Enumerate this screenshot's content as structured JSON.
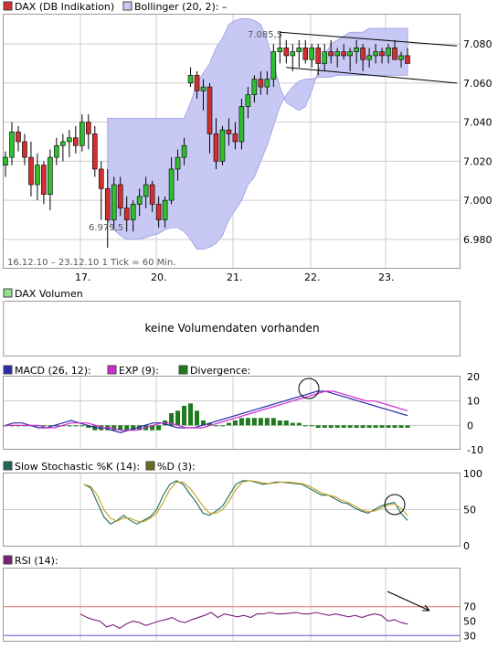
{
  "x_ticks": [
    "17.",
    "20.",
    "21.",
    "22.",
    "23."
  ],
  "info_text": "16.12.10 – 23.12.10    1 Tick = 60 Min.",
  "colors": {
    "up": "#2fbf2f",
    "down": "#d23030",
    "band_fill": "#c8c8f5",
    "band_line": "#9a9ae6",
    "macd": "#2a2aaa",
    "exp": "#d02bd0",
    "divergence": "#1d7a1d",
    "k": "#1e6a5a",
    "d": "#c2a020",
    "rsi": "#7a1f7a",
    "grid": "#cccccc",
    "rsi70": "#e07070",
    "rsi30": "#5a5ad0"
  },
  "panels": {
    "price": {
      "legend": [
        {
          "label": "DAX (DB Indikation)",
          "color": "#d23030"
        },
        {
          "label": "Bollinger (20, 2):  –",
          "color": "#c8c8f5"
        }
      ],
      "annotation_high": "7.085,5",
      "annotation_low": "6.979,5"
    },
    "volume": {
      "legend": [
        {
          "label": "DAX Volumen",
          "color": "#8fe08f"
        }
      ],
      "message": "keine Volumendaten vorhanden"
    },
    "macd": {
      "legend": [
        {
          "label": "MACD (26, 12):",
          "color": "#2a2aaa"
        },
        {
          "label": "EXP (9):",
          "color": "#d02bd0"
        },
        {
          "label": "Divergence:",
          "color": "#1d7a1d"
        }
      ]
    },
    "stoch": {
      "legend": [
        {
          "label": "Slow Stochastic %K (14):",
          "color": "#1e6a5a"
        },
        {
          "label": "%D (3):",
          "color": "#6b6b1e"
        }
      ]
    },
    "rsi": {
      "legend": [
        {
          "label": "RSI (14):",
          "color": "#7a1f7a"
        }
      ]
    }
  },
  "chart_data": [
    {
      "type": "candlestick",
      "title": "DAX (DB Indikation)",
      "xlabel": "",
      "ylabel": "",
      "period": "16.12.10 – 23.12.10",
      "interval": "1 Tick = 60 Min.",
      "ylim": [
        6965,
        7095
      ],
      "yticks": [
        6980,
        7000,
        7020,
        7040,
        7060,
        7080
      ],
      "ytick_labels": [
        "6.980",
        "7.000",
        "7.020",
        "7.040",
        "7.060",
        "7.080"
      ],
      "day_boundaries": [
        "17.",
        "20.",
        "21.",
        "22.",
        "23."
      ],
      "high": 7085.5,
      "low": 6979.5,
      "ohlc": [
        [
          7018,
          7025,
          7012,
          7022
        ],
        [
          7022,
          7040,
          7018,
          7035
        ],
        [
          7035,
          7038,
          7025,
          7030
        ],
        [
          7030,
          7034,
          7018,
          7022
        ],
        [
          7022,
          7030,
          7002,
          7008
        ],
        [
          7008,
          7024,
          7000,
          7018
        ],
        [
          7018,
          7020,
          6998,
          7003
        ],
        [
          7003,
          7026,
          6995,
          7022
        ],
        [
          7022,
          7032,
          7018,
          7028
        ],
        [
          7028,
          7034,
          7020,
          7030
        ],
        [
          7030,
          7036,
          7022,
          7032
        ],
        [
          7032,
          7038,
          7024,
          7028
        ],
        [
          7028,
          7044,
          7025,
          7040
        ],
        [
          7040,
          7044,
          7026,
          7034
        ],
        [
          7034,
          7038,
          7012,
          7016
        ],
        [
          7016,
          7020,
          6990,
          7006
        ],
        [
          7006,
          7016,
          6979.5,
          6990
        ],
        [
          6990,
          7012,
          6985,
          7008
        ],
        [
          7008,
          7012,
          6992,
          6996
        ],
        [
          6996,
          7002,
          6984,
          6990
        ],
        [
          6990,
          7000,
          6984,
          6998
        ],
        [
          6998,
          7006,
          6992,
          7002
        ],
        [
          7002,
          7012,
          6996,
          7008
        ],
        [
          7008,
          7010,
          6994,
          6998
        ],
        [
          6998,
          7002,
          6986,
          6990
        ],
        [
          6990,
          7002,
          6986,
          7000
        ],
        [
          7000,
          7022,
          6998,
          7016
        ],
        [
          7016,
          7026,
          7010,
          7022
        ],
        [
          7022,
          7032,
          7018,
          7028
        ],
        [
          7060,
          7068,
          7058,
          7064
        ],
        [
          7064,
          7066,
          7052,
          7056
        ],
        [
          7056,
          7062,
          7046,
          7058
        ],
        [
          7058,
          7060,
          7024,
          7034
        ],
        [
          7034,
          7042,
          7016,
          7020
        ],
        [
          7020,
          7038,
          7018,
          7036
        ],
        [
          7036,
          7042,
          7028,
          7034
        ],
        [
          7034,
          7040,
          7026,
          7030
        ],
        [
          7030,
          7052,
          7026,
          7048
        ],
        [
          7048,
          7058,
          7042,
          7054
        ],
        [
          7054,
          7064,
          7050,
          7062
        ],
        [
          7062,
          7066,
          7054,
          7058
        ],
        [
          7058,
          7066,
          7054,
          7062
        ],
        [
          7062,
          7080,
          7058,
          7076
        ],
        [
          7076,
          7085.5,
          7070,
          7078
        ],
        [
          7078,
          7082,
          7070,
          7074
        ],
        [
          7074,
          7080,
          7066,
          7076
        ],
        [
          7076,
          7082,
          7068,
          7078
        ],
        [
          7078,
          7082,
          7070,
          7072
        ],
        [
          7072,
          7080,
          7068,
          7078
        ],
        [
          7078,
          7080,
          7064,
          7070
        ],
        [
          7070,
          7080,
          7066,
          7076
        ],
        [
          7076,
          7082,
          7070,
          7074
        ],
        [
          7074,
          7078,
          7068,
          7076
        ],
        [
          7076,
          7080,
          7072,
          7074
        ],
        [
          7074,
          7078,
          7066,
          7076
        ],
        [
          7076,
          7082,
          7070,
          7078
        ],
        [
          7078,
          7080,
          7066,
          7072
        ],
        [
          7072,
          7078,
          7068,
          7074
        ],
        [
          7074,
          7080,
          7070,
          7076
        ],
        [
          7076,
          7078,
          7070,
          7074
        ],
        [
          7074,
          7080,
          7070,
          7078
        ],
        [
          7078,
          7082,
          7072,
          7072
        ],
        [
          7072,
          7076,
          7068,
          7074
        ],
        [
          7074,
          7078,
          7070,
          7070
        ]
      ],
      "bollinger": {
        "start_index": 16,
        "upper": [
          7042,
          7042,
          7042,
          7042,
          7042,
          7042,
          7042,
          7042,
          7042,
          7042,
          7042,
          7042,
          7042,
          7050,
          7060,
          7065,
          7070,
          7078,
          7083,
          7090,
          7092,
          7093,
          7093,
          7092,
          7090,
          7082,
          7070,
          7058,
          7050,
          7048,
          7046,
          7048,
          7056,
          7066,
          7074,
          7080,
          7082,
          7084,
          7086,
          7086,
          7086,
          7088,
          7088,
          7088,
          7088,
          7088,
          7088,
          7088
        ],
        "lower": [
          6990,
          6985,
          6982,
          6980,
          6980,
          6980,
          6981,
          6982,
          6983,
          6985,
          6986,
          6986,
          6984,
          6980,
          6975,
          6975,
          6976,
          6978,
          6982,
          6990,
          6995,
          7000,
          7008,
          7012,
          7020,
          7028,
          7038,
          7048,
          7054,
          7058,
          7061,
          7062,
          7062,
          7063,
          7063,
          7063,
          7064,
          7064,
          7064,
          7064,
          7064,
          7064,
          7064,
          7064,
          7064,
          7064,
          7064,
          7064
        ]
      },
      "trend_channel": {
        "upper": [
          7086,
          7079
        ],
        "lower": [
          7068,
          7060
        ]
      }
    },
    {
      "type": "bar",
      "title": "DAX Volumen",
      "note": "keine Volumendaten vorhanden",
      "values": []
    },
    {
      "type": "line",
      "title": "MACD",
      "ylim": [
        -10,
        20
      ],
      "yticks": [
        -10,
        0,
        10,
        20
      ],
      "series": [
        {
          "name": "MACD (26, 12)",
          "values": [
            0,
            1,
            1,
            0,
            -1,
            -1,
            0,
            1,
            2,
            1,
            0,
            -1,
            -1,
            -2,
            -3,
            -2,
            -1,
            0,
            1,
            1,
            0,
            -1,
            -1,
            -1,
            0,
            1,
            2,
            3,
            4,
            5,
            6,
            7,
            8,
            9,
            10,
            11,
            12,
            13,
            14,
            14,
            13,
            12,
            11,
            10,
            9,
            8,
            7,
            6,
            5,
            4
          ]
        },
        {
          "name": "EXP (9)",
          "values": [
            0,
            0,
            0,
            0,
            0,
            -1,
            -1,
            0,
            1,
            1,
            1,
            0,
            -1,
            -1,
            -2,
            -2,
            -2,
            -1,
            0,
            1,
            1,
            0,
            -1,
            -1,
            -1,
            0,
            1,
            2,
            3,
            4,
            5,
            6,
            7,
            8,
            9,
            10,
            11,
            12,
            13,
            14,
            14,
            13,
            12,
            11,
            10,
            10,
            9,
            8,
            7,
            6
          ]
        },
        {
          "name": "Divergence",
          "values": [
            0,
            0,
            0,
            0,
            0,
            0,
            0,
            0,
            0,
            0,
            0,
            0,
            0,
            -1,
            -2,
            -2,
            -2,
            -2,
            -2,
            -2,
            -2,
            -2,
            -2,
            -2,
            -2,
            2,
            5,
            6,
            8,
            9,
            6,
            2,
            1,
            0,
            0,
            1,
            2,
            3,
            3,
            3,
            3,
            3,
            3,
            2,
            2,
            1,
            1,
            0,
            0,
            -1,
            -1,
            -1,
            -1,
            -1,
            -1,
            -1,
            -1,
            -1,
            -1,
            -1,
            -1,
            -1,
            -1,
            -1
          ]
        }
      ]
    },
    {
      "type": "line",
      "title": "Slow Stochastic",
      "ylim": [
        0,
        100
      ],
      "yticks": [
        0,
        50,
        100
      ],
      "series": [
        {
          "name": "Slow Stochastic %K (14)",
          "values": [
            85,
            80,
            60,
            40,
            30,
            35,
            42,
            35,
            30,
            35,
            40,
            50,
            70,
            85,
            90,
            85,
            72,
            60,
            45,
            42,
            48,
            55,
            70,
            85,
            90,
            90,
            88,
            85,
            86,
            88,
            88,
            87,
            86,
            85,
            80,
            75,
            70,
            70,
            65,
            60,
            58,
            52,
            48,
            45,
            50,
            55,
            58,
            60,
            45,
            35
          ]
        },
        {
          "name": "%D (3)",
          "values": [
            85,
            82,
            70,
            50,
            38,
            34,
            38,
            38,
            34,
            33,
            38,
            45,
            60,
            78,
            88,
            88,
            80,
            68,
            55,
            45,
            45,
            50,
            62,
            78,
            88,
            90,
            89,
            87,
            86,
            87,
            88,
            88,
            87,
            86,
            83,
            78,
            73,
            70,
            68,
            63,
            60,
            55,
            50,
            47,
            48,
            52,
            56,
            58,
            52,
            42
          ]
        }
      ]
    },
    {
      "type": "line",
      "title": "RSI",
      "ylim": [
        0,
        100
      ],
      "yticks": [
        30,
        50,
        70
      ],
      "reference_lines": [
        70,
        30
      ],
      "series": [
        {
          "name": "RSI (14)",
          "values": [
            60,
            55,
            52,
            50,
            42,
            45,
            40,
            46,
            50,
            48,
            44,
            47,
            50,
            52,
            55,
            50,
            48,
            52,
            55,
            58,
            62,
            55,
            60,
            58,
            56,
            58,
            55,
            60,
            60,
            62,
            60,
            60,
            61,
            62,
            60,
            60,
            62,
            60,
            58,
            60,
            58,
            56,
            58,
            55,
            58,
            60,
            58,
            50,
            52,
            48,
            46
          ]
        }
      ]
    }
  ]
}
